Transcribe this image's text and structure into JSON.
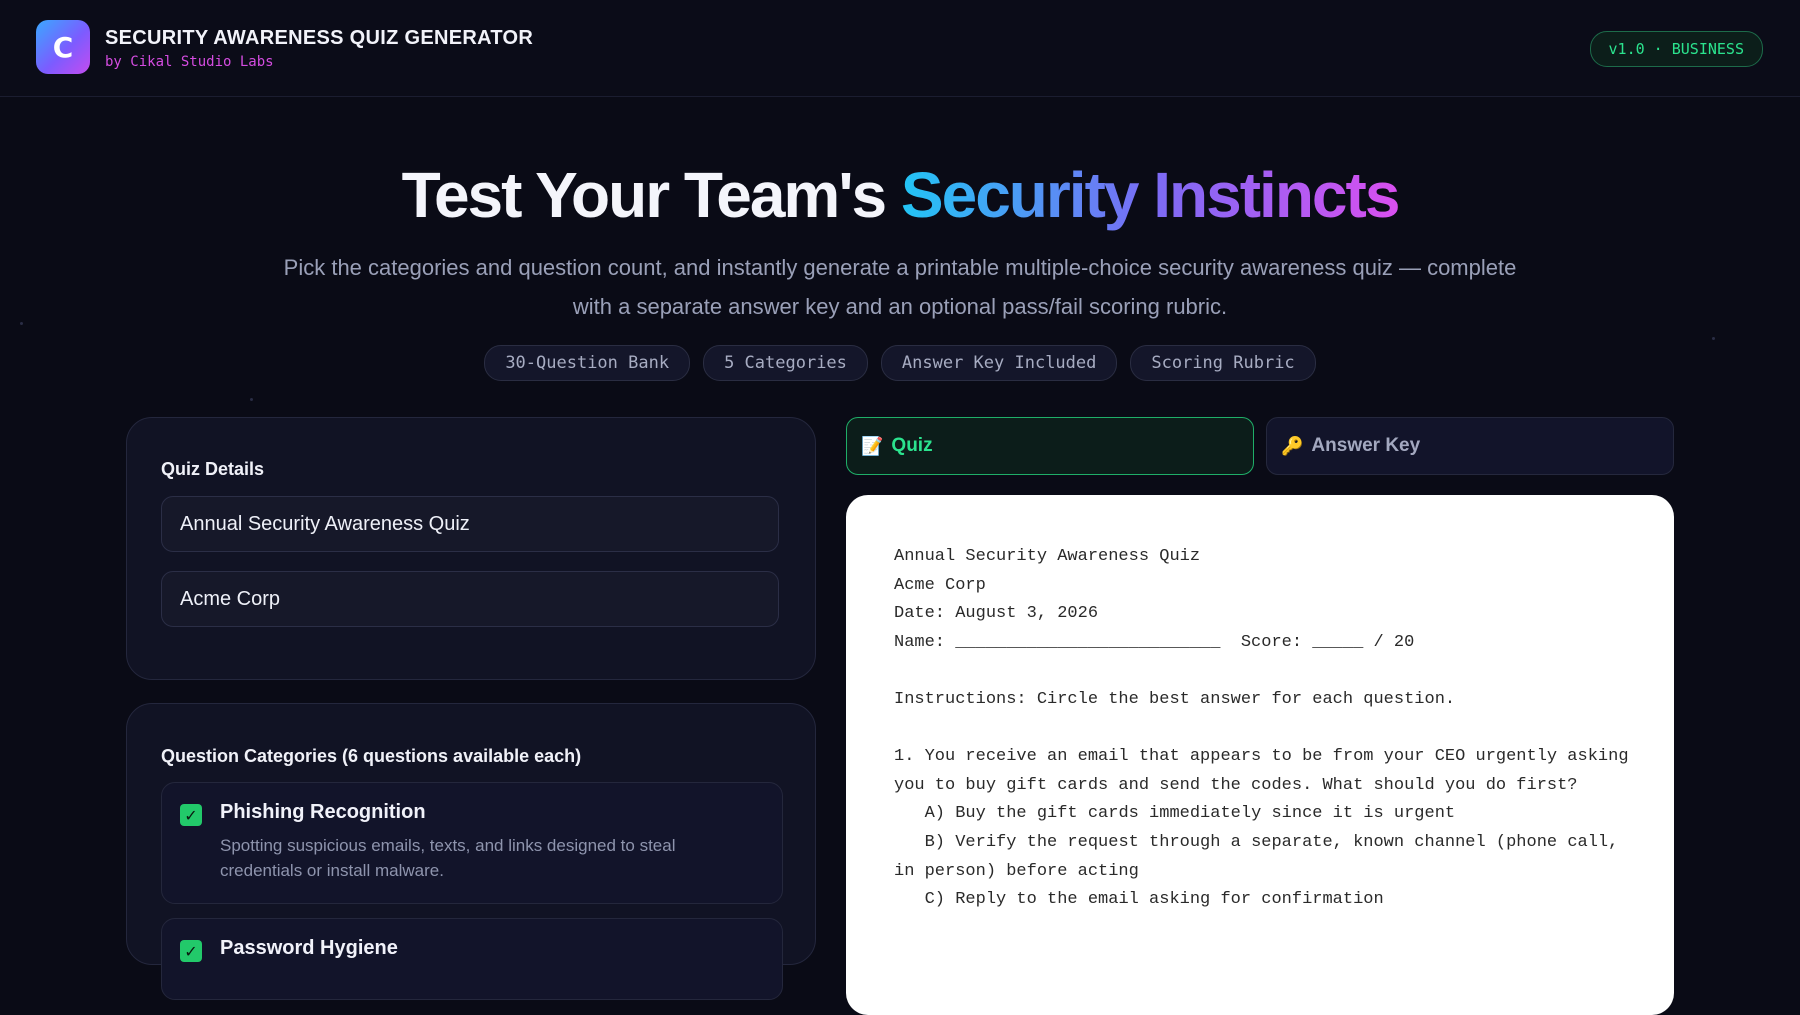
{
  "header": {
    "logo_letter": "C",
    "title": "SECURITY AWARENESS QUIZ GENERATOR",
    "subtitle": "by Cikal Studio Labs",
    "version_badge": "v1.0 · BUSINESS"
  },
  "hero": {
    "title_plain": "Test Your Team's ",
    "title_gradient": "Security Instincts",
    "description": "Pick the categories and question count, and instantly generate a printable multiple-choice security awareness quiz — complete with a separate answer key and an optional pass/fail scoring rubric.",
    "chips": [
      "30-Question Bank",
      "5 Categories",
      "Answer Key Included",
      "Scoring Rubric"
    ]
  },
  "quiz_details": {
    "heading": "Quiz Details",
    "quiz_title_value": "Annual Security Awareness Quiz",
    "organization_value": "Acme Corp"
  },
  "categories": {
    "heading": "Question Categories (6 questions available each)",
    "items": [
      {
        "title": "Phishing Recognition",
        "description": "Spotting suspicious emails, texts, and links designed to steal credentials or install malware.",
        "checked": true
      },
      {
        "title": "Password Hygiene",
        "description": "",
        "checked": true
      }
    ]
  },
  "tabs": {
    "quiz_icon": "📝",
    "quiz_label": "Quiz",
    "key_icon": "🔑",
    "key_label": "Answer Key",
    "active": "quiz"
  },
  "preview": {
    "lines": [
      "Annual Security Awareness Quiz",
      "Acme Corp",
      "Date: August 3, 2026",
      "Name: __________________________  Score: _____ / 20",
      "",
      "Instructions: Circle the best answer for each question.",
      "",
      "1. You receive an email that appears to be from your CEO urgently asking you to buy gift cards and send the codes. What should you do first?",
      "   A) Buy the gift cards immediately since it is urgent",
      "   B) Verify the request through a separate, known channel (phone call, in person) before acting",
      "   C) Reply to the email asking for confirmation"
    ]
  },
  "colors": {
    "background": "#0a0b16",
    "accent_green": "#2be38e",
    "accent_magenta": "#d44ce0",
    "gradient_start": "#22c5f5",
    "gradient_end": "#d94ff0"
  }
}
